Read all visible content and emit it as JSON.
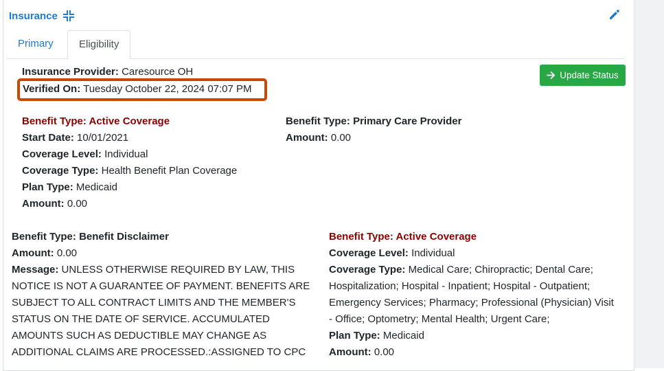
{
  "card": {
    "title": "Insurance"
  },
  "tabs": [
    {
      "label": "Primary"
    },
    {
      "label": "Eligibility"
    }
  ],
  "summary": {
    "provider_label": "Insurance Provider:",
    "provider_value": "Caresource OH",
    "verified_label": "Verified On:",
    "verified_value": "Tuesday October 22, 2024 07:07 PM"
  },
  "update_button": {
    "label": "Update Status"
  },
  "benefit_left": {
    "type_label": "Benefit Type: Active Coverage",
    "start_label": "Start Date:",
    "start_value": "10/01/2021",
    "level_label": "Coverage Level:",
    "level_value": "Individual",
    "ctype_label": "Coverage Type:",
    "ctype_value": "Health Benefit Plan Coverage",
    "plan_label": "Plan Type:",
    "plan_value": "Medicaid",
    "amount_label": "Amount:",
    "amount_value": "0.00"
  },
  "benefit_right": {
    "type_label": "Benefit Type: Primary Care Provider",
    "amount_label": "Amount:",
    "amount_value": "0.00"
  },
  "disclaimer": {
    "type_label": "Benefit Type: Benefit Disclaimer",
    "amount_label": "Amount:",
    "amount_value": "0.00",
    "message_label": "Message:",
    "message_value": "UNLESS OTHERWISE REQUIRED BY LAW, THIS NOTICE IS NOT A GUARANTEE OF PAYMENT. BENEFITS ARE SUBJECT TO ALL CONTRACT LIMITS AND THE MEMBER'S STATUS ON THE DATE OF SERVICE. ACCUMULATED AMOUNTS SUCH AS DEDUCTIBLE MAY CHANGE AS ADDITIONAL CLAIMS ARE PROCESSED.:ASSIGNED TO CPC"
  },
  "coverage2": {
    "type_label": "Benefit Type: Active Coverage",
    "level_label": "Coverage Level:",
    "level_value": "Individual",
    "ctype_label": "Coverage Type:",
    "ctype_value": "Medical Care; Chiropractic; Dental Care; Hospitalization; Hospital - Inpatient; Hospital - Outpatient; Emergency Services; Pharmacy; Professional (Physician) Visit - Office; Optometry; Mental Health; Urgent Care;",
    "plan_label": "Plan Type:",
    "plan_value": "Medicaid",
    "amount_label": "Amount:",
    "amount_value": "0.00"
  },
  "icons": {
    "collapse": "compress-arrows-icon",
    "edit": "pencil-icon",
    "arrow": "arrow-right-icon"
  },
  "colors": {
    "link": "#1e7ad6",
    "benefit_red": "#8b0000",
    "highlight": "#c94a06",
    "button_green": "#28a745"
  }
}
